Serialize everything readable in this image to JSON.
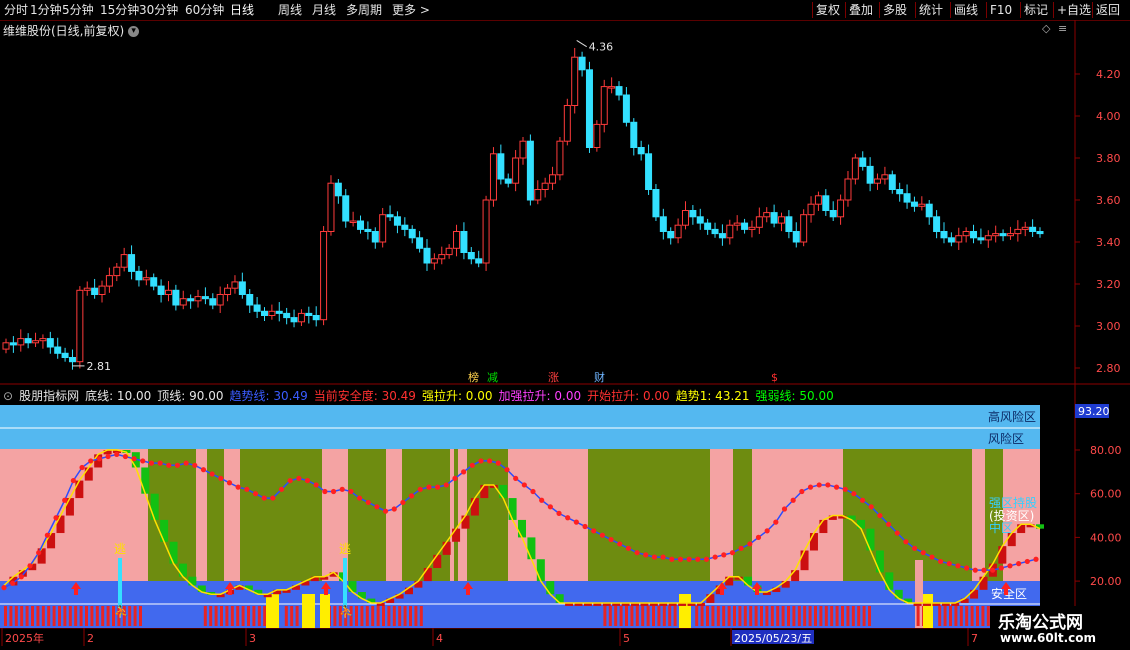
{
  "toolbar": {
    "left": [
      "分时",
      "1分钟",
      "5分钟",
      "15分钟",
      "30分钟",
      "60分钟",
      "日线",
      "周线",
      "月线",
      "多周期",
      "更多 >"
    ],
    "active_index": 6,
    "right": [
      "复权",
      "叠加",
      "多股",
      "统计",
      "画线",
      "F10",
      "标记",
      "+自选",
      "返回"
    ]
  },
  "chart_title": "维维股份(日线,前复权)",
  "price_axis": [
    "4.20",
    "4.00",
    "3.80",
    "3.60",
    "3.40",
    "3.20",
    "3.00",
    "2.80"
  ],
  "high_label": "4.36",
  "low_label": "2.81",
  "event_markers": [
    {
      "text": "榜",
      "color": "#ffd24d"
    },
    {
      "text": "减",
      "color": "#00e000"
    },
    {
      "text": "涨",
      "color": "#ff4040"
    },
    {
      "text": "财",
      "color": "#6fb5ff"
    },
    {
      "text": "$",
      "color": "#ff3030"
    }
  ],
  "indicator": {
    "name": "股朋指标网",
    "params": [
      {
        "label": "底线: 10.00",
        "color": "#e6e6e6"
      },
      {
        "label": "顶线: 90.00",
        "color": "#e6e6e6"
      },
      {
        "label": "趋势线: 30.49",
        "color": "#3a5cff"
      },
      {
        "label": "当前安全度: 30.49",
        "color": "#ff3030"
      },
      {
        "label": "强拉升: 0.00",
        "color": "#ffff00"
      },
      {
        "label": "加强拉升: 0.00",
        "color": "#ff40ff"
      },
      {
        "label": "开始拉升: 0.00",
        "color": "#ff3030"
      },
      {
        "label": "趋势1: 43.21",
        "color": "#ffff00"
      },
      {
        "label": "强弱线: 50.00",
        "color": "#00ff00"
      }
    ],
    "axis": [
      "80.00",
      "60.00",
      "40.00",
      "20.00"
    ],
    "current_value": "93.20",
    "zone_labels": [
      "高风险区",
      "风险区",
      "安全区"
    ],
    "side_labels": [
      "强区持股",
      "(投资区)",
      "中区"
    ],
    "escape_label": "逃"
  },
  "date_labels": [
    "2025年",
    "2",
    "3",
    "4",
    "5",
    "2025/05/23/五",
    "7"
  ],
  "watermark": {
    "title": "乐淘公式网",
    "url": "www.60lt.com"
  },
  "colors": {
    "up": "#ff3b3b",
    "down": "#33e0ff",
    "pink": "#f4a3a3",
    "olive": "#6e8c10",
    "blue": "#4169ee",
    "sky": "#54b8f0"
  }
}
